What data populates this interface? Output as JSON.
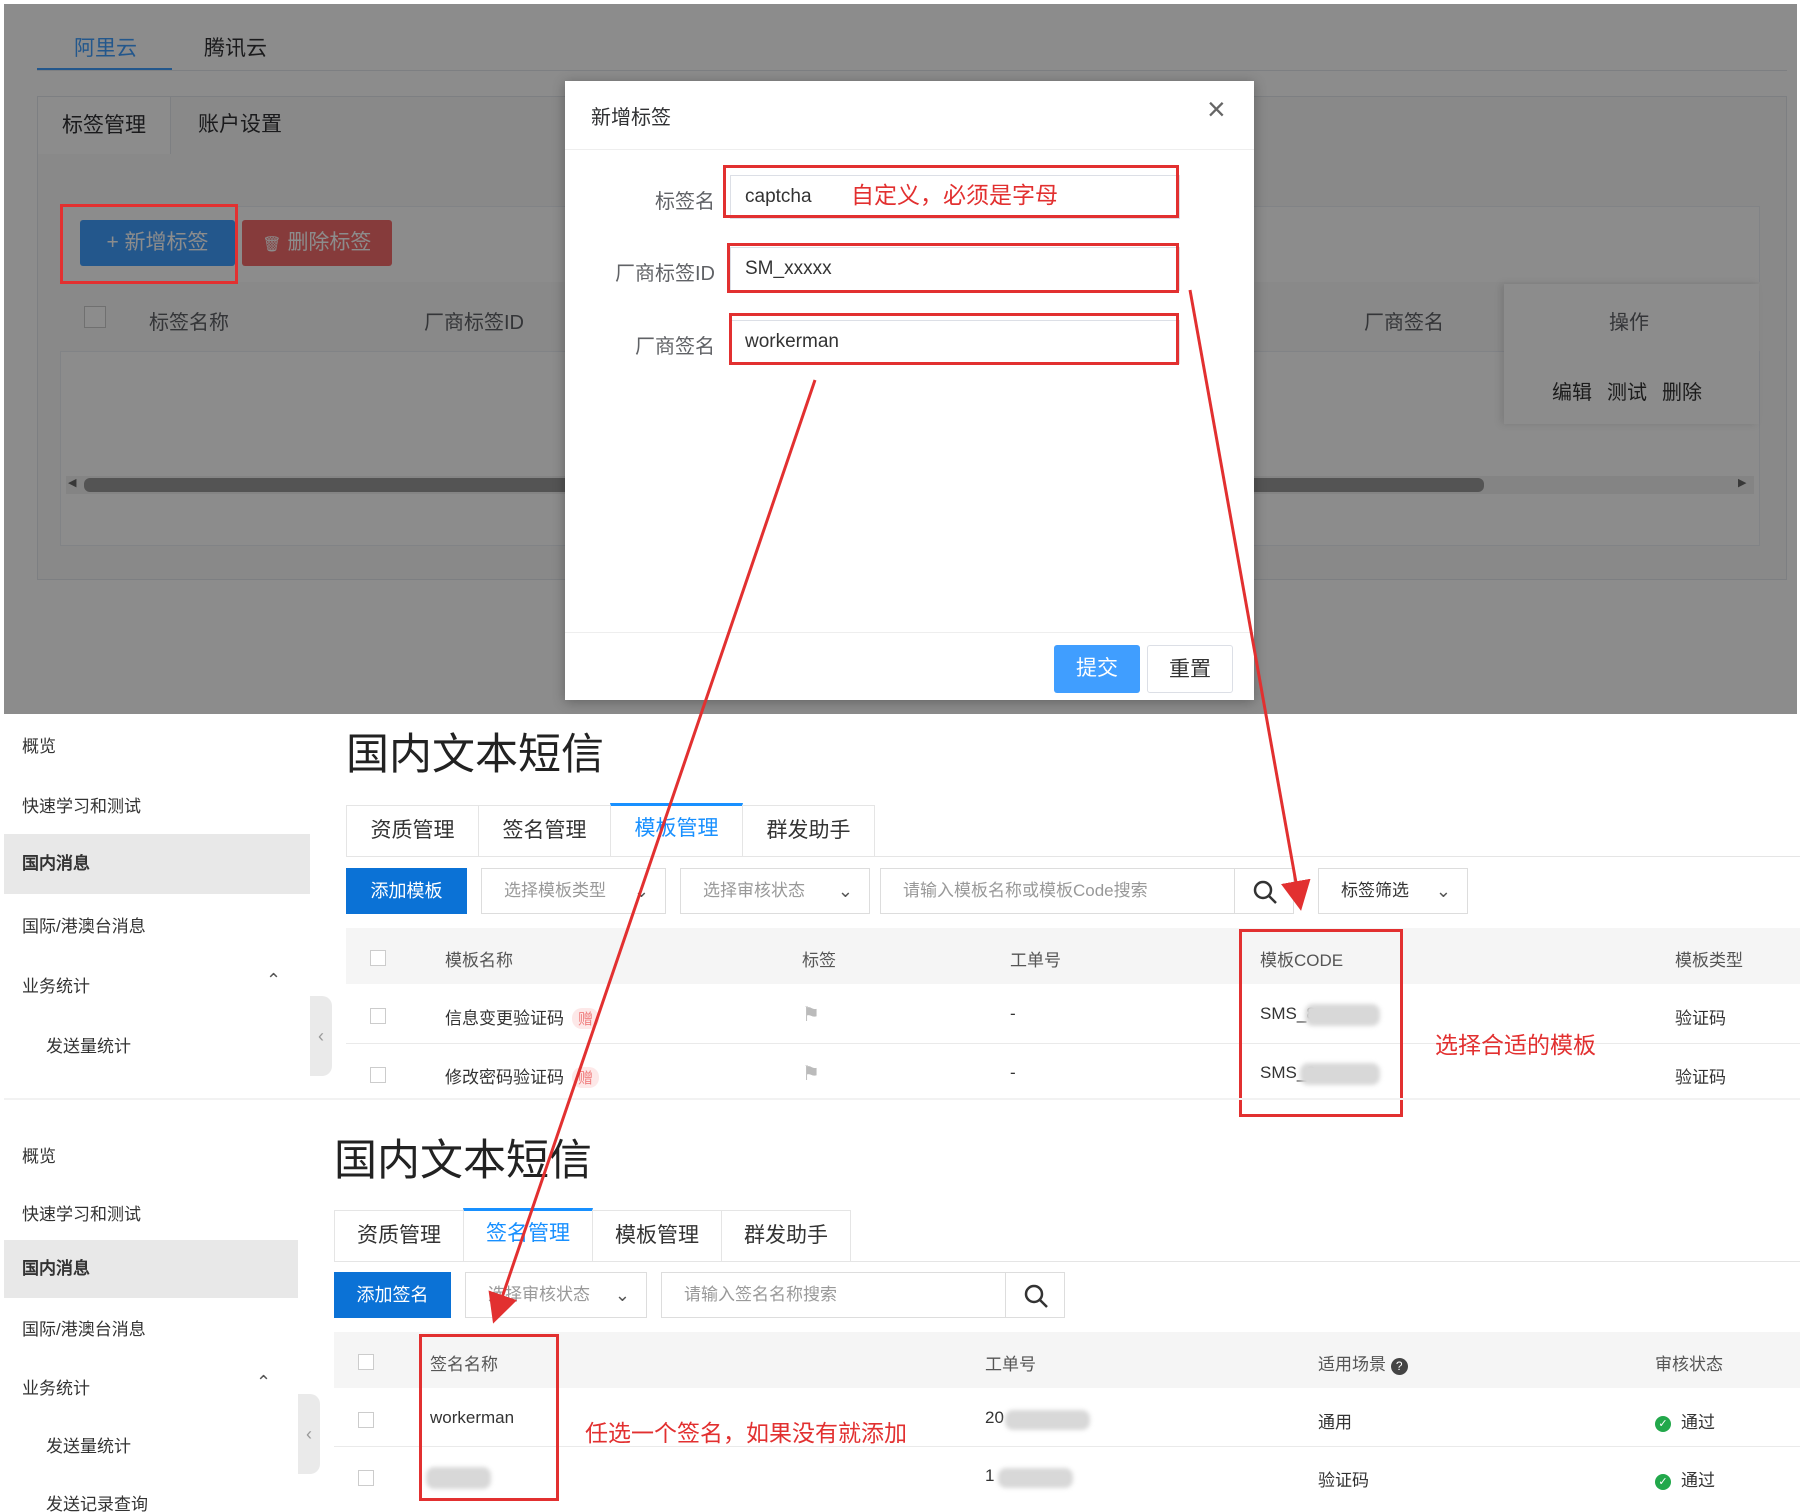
{
  "top": {
    "provider_tabs": [
      "阿里云",
      "腾讯云"
    ],
    "sub_tabs": [
      "标签管理",
      "账户设置"
    ],
    "add_button": "+ 新增标签",
    "delete_icon": "trash-icon",
    "delete_button": "删除标签",
    "columns": [
      "标签名称",
      "厂商标签ID",
      "厂商签名",
      "操作"
    ],
    "ops": [
      "编辑",
      "测试",
      "删除"
    ],
    "dialog": {
      "title": "新增标签",
      "close_glyph": "×",
      "fields": [
        {
          "label": "标签名",
          "value": "captcha"
        },
        {
          "label": "厂商标签ID",
          "value": "SM_xxxxx"
        },
        {
          "label": "厂商签名",
          "value": "workerman"
        }
      ],
      "annotation": "自定义，必须是字母",
      "submit": "提交",
      "reset": "重置"
    }
  },
  "template_section": {
    "sidebar": [
      "概览",
      "快速学习和测试",
      "国内消息",
      "国际/港澳台消息",
      "业务统计",
      "发送量统计"
    ],
    "title": "国内文本短信",
    "tabs": [
      "资质管理",
      "签名管理",
      "模板管理",
      "群发助手"
    ],
    "add_button": "添加模板",
    "type_select": "选择模板类型",
    "status_select": "选择审核状态",
    "search_placeholder": "请输入模板名称或模板Code搜索",
    "tag_filter": "标签筛选",
    "columns": [
      "模板名称",
      "标签",
      "工单号",
      "模板CODE",
      "模板类型"
    ],
    "rows": [
      {
        "name": "信息变更验证码",
        "badge": "赠",
        "ticket": "-",
        "code": "SMS_8",
        "type": "验证码"
      },
      {
        "name": "修改密码验证码",
        "badge": "赠",
        "ticket": "-",
        "code": "SMS_8",
        "type": "验证码"
      }
    ],
    "annotation": "选择合适的模板"
  },
  "sign_section": {
    "sidebar": [
      "概览",
      "快速学习和测试",
      "国内消息",
      "国际/港澳台消息",
      "业务统计",
      "发送量统计",
      "发送记录查询"
    ],
    "title": "国内文本短信",
    "tabs": [
      "资质管理",
      "签名管理",
      "模板管理",
      "群发助手"
    ],
    "add_button": "添加签名",
    "status_select": "选择审核状态",
    "search_placeholder": "请输入签名名称搜索",
    "columns": [
      "签名名称",
      "工单号",
      "适用场景",
      "审核状态"
    ],
    "rows": [
      {
        "name": "workerman",
        "ticket": "20",
        "scene": "通用",
        "status": "通过"
      },
      {
        "name": "",
        "ticket": "1",
        "scene": "验证码",
        "status": "通过"
      }
    ],
    "annotation": "任选一个签名，如果没有就添加"
  },
  "colors": {
    "annotation_red": "#e23030",
    "primary_blue": "#409eff",
    "console_blue": "#0b72d6"
  }
}
